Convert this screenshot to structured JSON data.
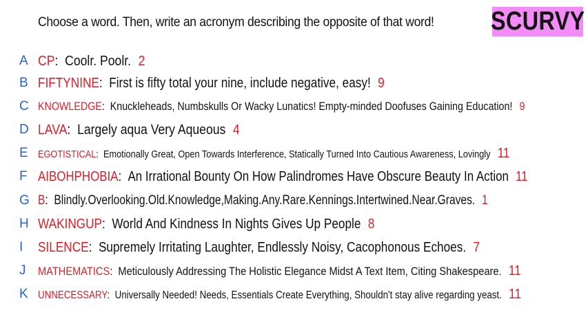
{
  "header": {
    "prompt": "Choose a word. Then, write an acronym describing the opposite of that word!",
    "badge": "SCURVY"
  },
  "colors": {
    "letter": "#2a64c8",
    "word": "#d8202a",
    "number": "#d8202a",
    "badge_bg": "#f38cf6"
  },
  "rows": [
    {
      "letter": "A",
      "word": "CP",
      "acronym": "Coolr. Poolr.",
      "score": "2"
    },
    {
      "letter": "B",
      "word": "FIFTYNINE",
      "acronym": "First is fifty total your nine, include negative, easy!",
      "score": "9"
    },
    {
      "letter": "C",
      "word": "KNOWLEDGE",
      "acronym": "Knuckleheads, Numbskulls Or Wacky Lunatics! Empty-minded Doofuses Gaining Education!",
      "score": "9"
    },
    {
      "letter": "D",
      "word": "LAVA",
      "acronym": "Largely aqua Very Aqueous",
      "score": "4"
    },
    {
      "letter": "E",
      "word": "EGOTISTICAL",
      "acronym": "Emotionally Great, Open Towards Interference, Statically Turned Into Cautious Awareness, Lovingly",
      "score": "11"
    },
    {
      "letter": "F",
      "word": "AIBOHPHOBIA",
      "acronym": "An Irrational Bounty On How Palindromes Have Obscure Beauty In Action",
      "score": "11"
    },
    {
      "letter": "G",
      "word": "B",
      "acronym": "Blindly.Overlooking.Old.Knowledge,Making.Any.Rare.Kennings.Intertwined.Near.Graves.",
      "score": "1"
    },
    {
      "letter": "H",
      "word": "WAKINGUP",
      "acronym": "World And Kindness In Nights Gives Up People",
      "score": "8"
    },
    {
      "letter": "I",
      "word": "SILENCE",
      "acronym": "Supremely Irritating Laughter, Endlessly Noisy, Cacophonous Echoes.",
      "score": "7"
    },
    {
      "letter": "J",
      "word": "MATHEMATICS",
      "acronym": "Meticulously Addressing The Holistic Elegance Midst A Text Item, Citing Shakespeare.",
      "score": "11"
    },
    {
      "letter": "K",
      "word": "UNNECESSARY",
      "acronym": "Universally Needed! Needs, Essentials Create Everything, Shouldn't stay alive regarding yeast.",
      "score": "11"
    }
  ]
}
